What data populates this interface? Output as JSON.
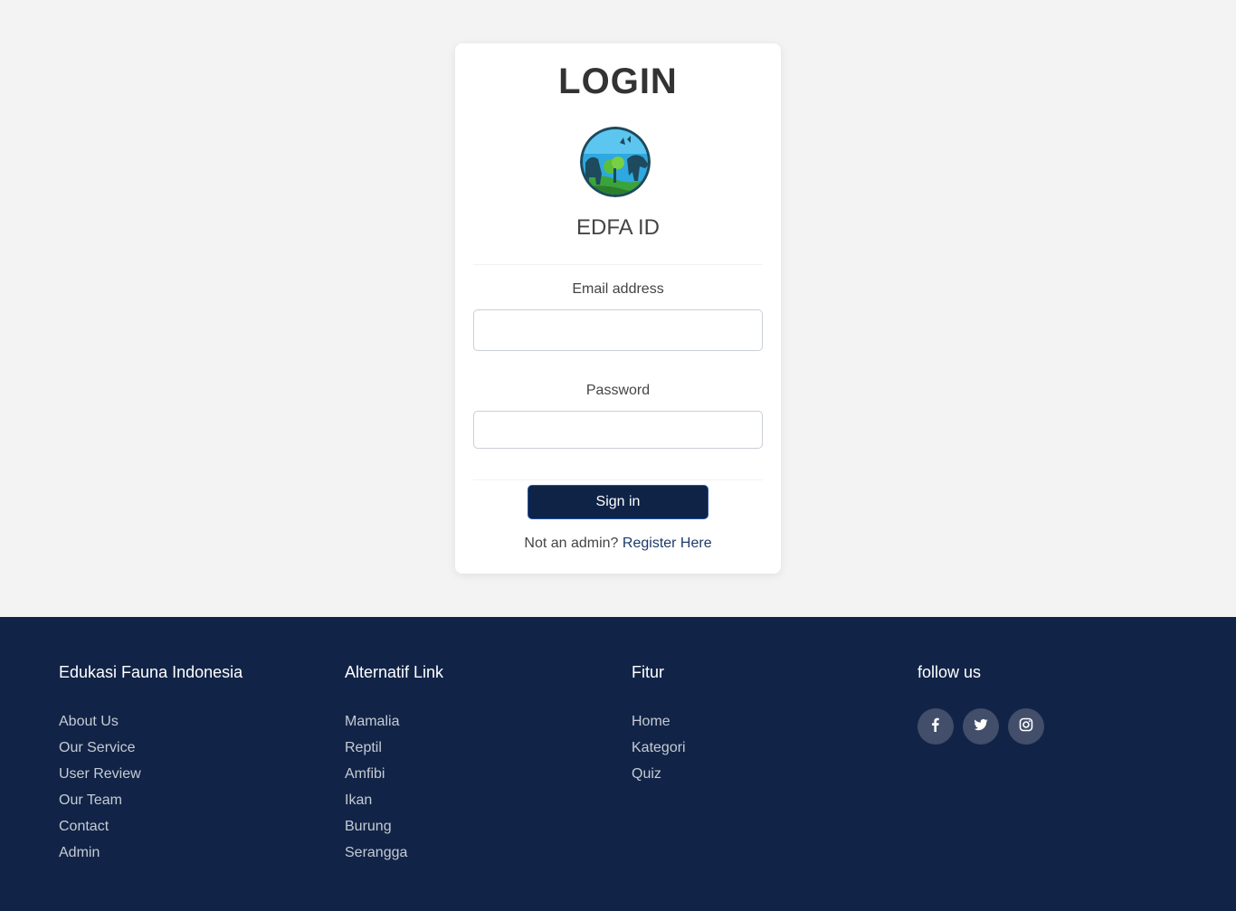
{
  "login": {
    "title": "LOGIN",
    "brand": "EDFA ID",
    "email_label": "Email address",
    "email_value": "",
    "password_label": "Password",
    "password_value": "",
    "signin_label": "Sign in",
    "register_prompt": "Not an admin?",
    "register_link": "Register Here"
  },
  "footer": {
    "col1": {
      "title": "Edukasi Fauna Indonesia",
      "items": [
        "About Us",
        "Our Service",
        "User Review",
        "Our Team",
        "Contact",
        "Admin"
      ]
    },
    "col2": {
      "title": "Alternatif Link",
      "items": [
        "Mamalia",
        "Reptil",
        "Amfibi",
        "Ikan",
        "Burung",
        "Serangga"
      ]
    },
    "col3": {
      "title": "Fitur",
      "items": [
        "Home",
        "Kategori",
        "Quiz"
      ]
    },
    "col4": {
      "title": "follow us",
      "socials": [
        "facebook-icon",
        "twitter-icon",
        "instagram-icon"
      ]
    }
  },
  "colors": {
    "page_bg": "#f3f3f3",
    "footer_bg": "#112447",
    "button_bg": "#0f2347",
    "link": "#1b3a6b"
  }
}
